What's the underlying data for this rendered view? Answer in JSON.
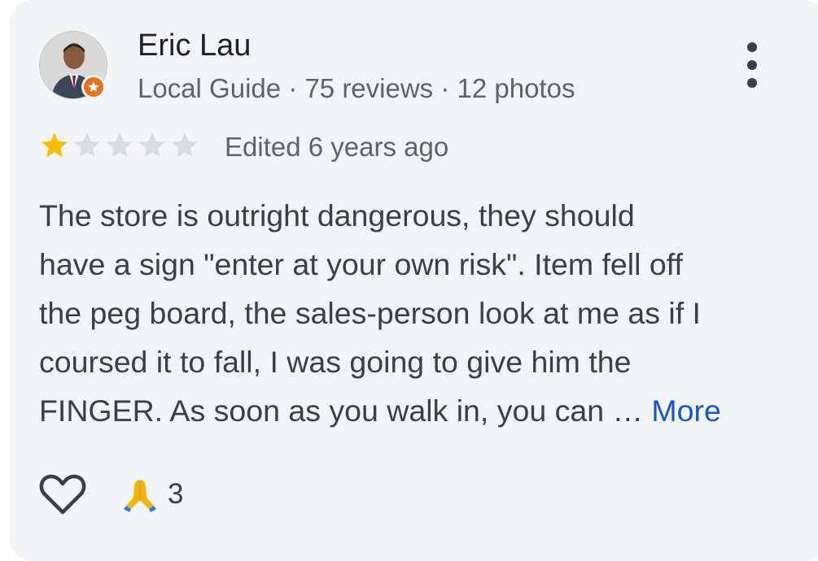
{
  "reviewer": {
    "name": "Eric Lau",
    "meta": "Local Guide · 75 reviews · 12 photos"
  },
  "rating": {
    "stars": 1,
    "max_stars": 5,
    "edited": "Edited 6 years ago"
  },
  "review": {
    "lines": [
      "The store is outright dangerous, they should",
      "have a sign \"enter at your own risk\". Item fell off",
      "the peg board, the sales-person look at me as if I",
      "coursed it to fall, I was going to give him the",
      "FINGER. As soon as you walk in, you can …"
    ],
    "more_label": "More"
  },
  "actions": {
    "like_icon": "heart-outline-icon",
    "reaction_icon": "folded-hands-emoji",
    "reaction_count": "3"
  },
  "colors": {
    "card_bg": "#f3f4f6",
    "star_filled": "#fbbc04",
    "star_empty": "#dadce0",
    "link": "#1a56c7",
    "badge": "#e8711c"
  }
}
